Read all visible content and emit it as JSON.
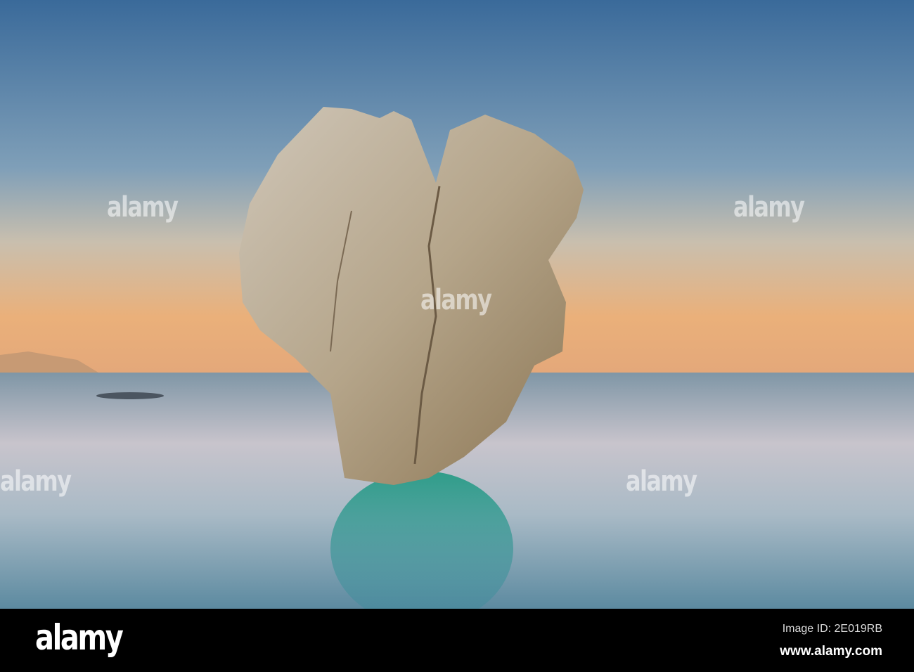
{
  "photo": {
    "subject": "heart-shaped-rock-in-sea",
    "colors": {
      "sky_top": "#3a6a9a",
      "sky_mid": "#8fa6b8",
      "horizon": "#eab07a",
      "sea": "#a9b6c2",
      "reflection": "#2f9a8a",
      "rock": "#b9ad9a"
    }
  },
  "watermark": {
    "text": "alamy"
  },
  "footer": {
    "logo": "alamy",
    "image_id": "Image ID: 2E019RB",
    "website": "www.alamy.com"
  }
}
